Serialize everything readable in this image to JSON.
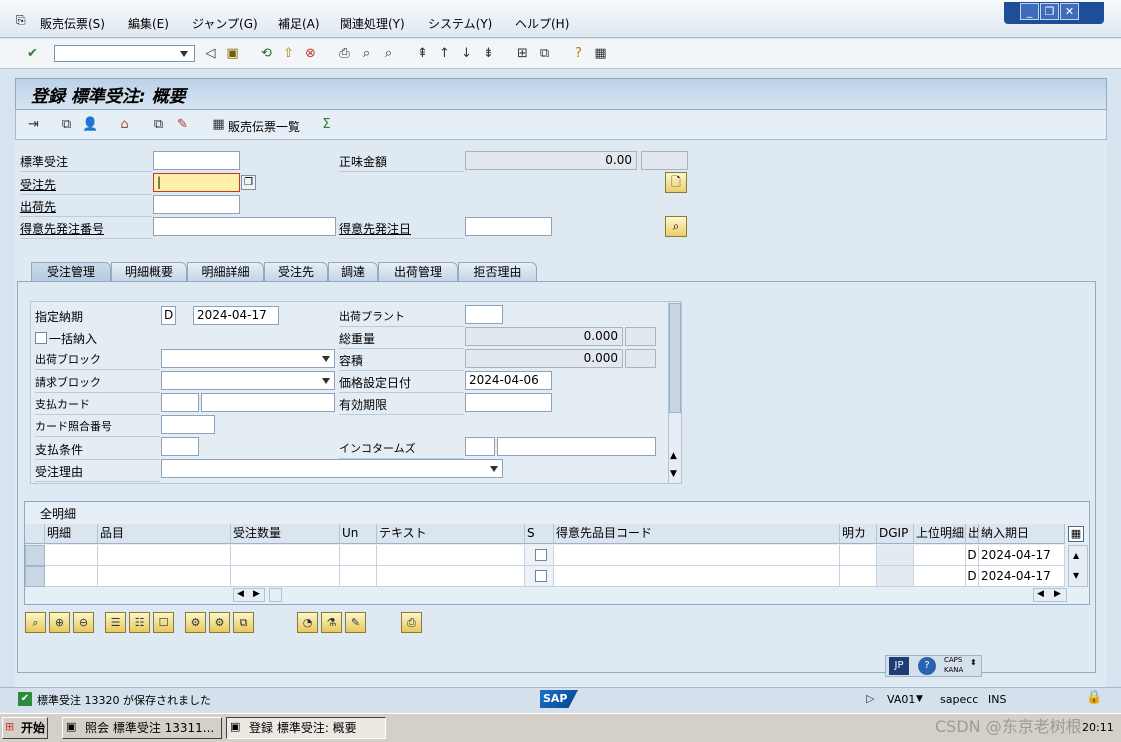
{
  "menu": {
    "items": [
      "販売伝票(S)",
      "編集(E)",
      "ジャンプ(G)",
      "補足(A)",
      "関連処理(Y)",
      "システム(Y)",
      "ヘルプ(H)"
    ]
  },
  "window": {
    "title": "登録 標準受注: 概要"
  },
  "app_toolbar": {
    "list_label": "販売伝票一覧"
  },
  "header": {
    "order_type_label": "標準受注",
    "sold_to_label": "受注先",
    "ship_to_label": "出荷先",
    "po_number_label": "得意先発注番号",
    "net_value_label": "正味金額",
    "net_value": "0.00",
    "po_date_label": "得意先発注日"
  },
  "tabs": [
    "受注管理",
    "明細概要",
    "明細詳細",
    "受注先",
    "調達",
    "出荷管理",
    "拒否理由"
  ],
  "form": {
    "req_delivery_label": "指定納期",
    "req_delivery_type": "D",
    "req_delivery_date": "2024-04-17",
    "complete_delivery_label": "一括納入",
    "delivery_block_label": "出荷ブロック",
    "billing_block_label": "請求ブロック",
    "payment_card_label": "支払カード",
    "card_verif_label": "カード照合番号",
    "payment_terms_label": "支払条件",
    "order_reason_label": "受注理由",
    "plant_label": "出荷プラント",
    "total_weight_label": "総重量",
    "total_weight": "0.000",
    "volume_label": "容積",
    "volume": "0.000",
    "pricing_date_label": "価格設定日付",
    "pricing_date": "2024-04-06",
    "valid_to_label": "有効期限",
    "incoterms_label": "インコタームズ"
  },
  "grid": {
    "title": "全明細",
    "columns": [
      "明細",
      "品目",
      "受注数量",
      "Un",
      "テキスト",
      "S",
      "得意先品目コード",
      "明カ",
      "DGIP",
      "上位明細",
      "出",
      "納入期日"
    ],
    "rows": [
      {
        "cat": "D",
        "date": "2024-04-17"
      },
      {
        "cat": "D",
        "date": "2024-04-17"
      }
    ]
  },
  "status": {
    "message": "標準受注 13320 が保存されました",
    "tcode": "VA01",
    "server": "sapecc",
    "mode": "INS",
    "caps": "CAPS",
    "kana": "KANA",
    "lang": "JP"
  },
  "taskbar": {
    "start": "开始",
    "task1": "照会 標準受注 13311...",
    "task2": "登録 標準受注: 概要",
    "clock": "20:11",
    "watermark": "CSDN @东京老树根"
  }
}
